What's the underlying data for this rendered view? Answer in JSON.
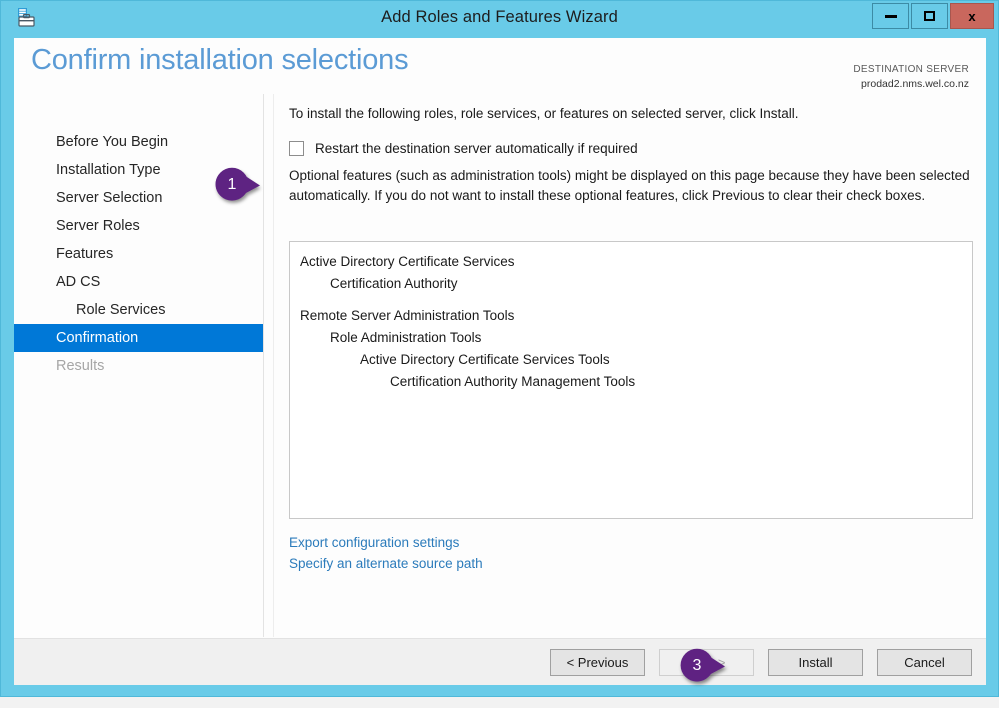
{
  "window": {
    "title": "Add Roles and Features Wizard",
    "icon": "server-toolbox-icon",
    "controls": {
      "minimize": "minimize-icon",
      "maximize": "maximize-icon",
      "close": "x"
    }
  },
  "header": {
    "page_title": "Confirm installation selections",
    "destination_label": "DESTINATION SERVER",
    "destination_server": "prodad2.nms.wel.co.nz"
  },
  "sidebar": {
    "items": [
      {
        "label": "Before You Begin",
        "state": "normal",
        "indent": 0
      },
      {
        "label": "Installation Type",
        "state": "normal",
        "indent": 0
      },
      {
        "label": "Server Selection",
        "state": "normal",
        "indent": 0
      },
      {
        "label": "Server Roles",
        "state": "normal",
        "indent": 0
      },
      {
        "label": "Features",
        "state": "normal",
        "indent": 0
      },
      {
        "label": "AD CS",
        "state": "normal",
        "indent": 0
      },
      {
        "label": "Role Services",
        "state": "normal",
        "indent": 1
      },
      {
        "label": "Confirmation",
        "state": "selected",
        "indent": 0
      },
      {
        "label": "Results",
        "state": "disabled",
        "indent": 0
      }
    ]
  },
  "main": {
    "intro": "To install the following roles, role services, or features on selected server, click Install.",
    "restart_checkbox": {
      "label": "Restart the destination server automatically if required",
      "checked": false
    },
    "note": "Optional features (such as administration tools) might be displayed on this page because they have been selected automatically. If you do not want to install these optional features, click Previous to clear their check boxes.",
    "selection_list": [
      {
        "label": "Active Directory Certificate Services",
        "indent": 0,
        "gap_after": false
      },
      {
        "label": "Certification Authority",
        "indent": 1,
        "gap_after": true
      },
      {
        "label": "Remote Server Administration Tools",
        "indent": 0,
        "gap_after": false
      },
      {
        "label": "Role Administration Tools",
        "indent": 1,
        "gap_after": false
      },
      {
        "label": "Active Directory Certificate Services Tools",
        "indent": 2,
        "gap_after": false
      },
      {
        "label": "Certification Authority Management Tools",
        "indent": 3,
        "gap_after": false
      }
    ],
    "links": [
      {
        "label": "Export configuration settings"
      },
      {
        "label": "Specify an alternate source path"
      }
    ]
  },
  "footer": {
    "buttons": [
      {
        "label": "< Previous",
        "state": "enabled"
      },
      {
        "label": "Next >",
        "state": "disabled"
      },
      {
        "label": "Install",
        "state": "enabled"
      },
      {
        "label": "Cancel",
        "state": "enabled"
      }
    ]
  },
  "annotations": {
    "color": "#5e2382",
    "badges": [
      {
        "number": "1",
        "target": "restart-checkbox"
      },
      {
        "number": "3",
        "target": "install-button"
      }
    ]
  },
  "colors": {
    "title_bar": "#69cbe8",
    "accent_blue": "#5b9bd5",
    "selection_blue": "#0078d7",
    "link_blue": "#2b7bbb",
    "close_red": "#c9675d",
    "callout_purple": "#5e2382"
  }
}
